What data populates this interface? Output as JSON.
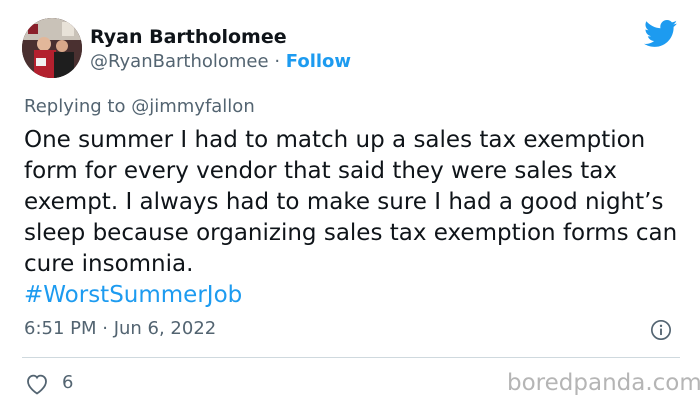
{
  "author": {
    "name": "Ryan Bartholomee",
    "handle": "@RyanBartholomee",
    "separator": "·",
    "follow_label": "Follow"
  },
  "reply_context": {
    "prefix": "Replying to",
    "mention": "@jimmyfallon"
  },
  "tweet": {
    "text": "One summer I had to match up a sales tax exemption form for every vendor that said they were sales tax exempt. I always had to make sure I had a good night’s sleep because organizing sales tax exemption forms can cure insomnia.",
    "hashtag": "#WorstSummerJob",
    "timestamp": "6:51 PM · Jun 6, 2022"
  },
  "engagement": {
    "likes": "6"
  },
  "watermark": "boredpanda.com",
  "icons": {
    "brand": "twitter-bird-icon",
    "info": "info-icon",
    "like": "heart-icon"
  },
  "colors": {
    "accent": "#1d9bf0",
    "secondary_text": "#536471",
    "primary_text": "#0f1419",
    "divider": "#cfd9de",
    "watermark": "#b5b5b5"
  }
}
